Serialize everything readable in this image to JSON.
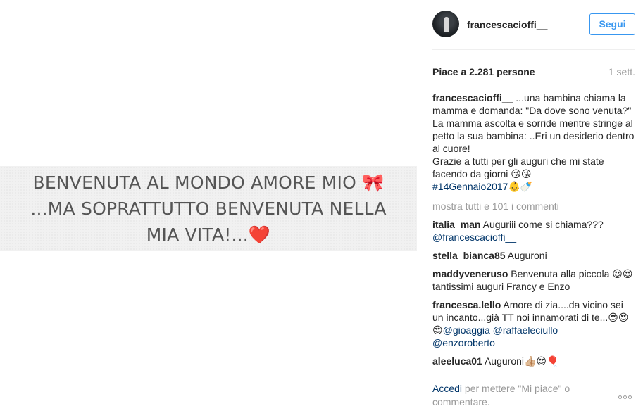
{
  "media": {
    "line1": "BENVENUTA AL MONDO AMORE MIO 🎀",
    "line2": "...MA SOPRATTUTTO BENVENUTA NELLA",
    "line3": "MIA VITA!...❤️"
  },
  "header": {
    "username": "francescacioffi__",
    "follow_label": "Segui"
  },
  "stats": {
    "likes": "Piace a 2.281 persone",
    "time": "1 sett."
  },
  "caption": {
    "user": "francescacioffi__",
    "text1": " ...una bambina chiama la mamma e domanda: \"Da dove sono venuta?\"",
    "text2": "La mamma ascolta e sorride mentre stringe al petto la sua bambina: ..Eri un desiderio dentro al cuore!",
    "text3": "Grazie a tutti per gli auguri che mi state facendo da giorni 😘😘",
    "hashtag": "#14Gennaio2017",
    "hashtag_emoji": "👶🍼"
  },
  "more_comments": "mostra tutti e 101 i commenti",
  "comments": [
    {
      "user": "italia_man",
      "text": " Auguriii come si chiama???",
      "mention": "@francescacioffi__"
    },
    {
      "user": "stella_bianca85",
      "text": " Auguroni"
    },
    {
      "user": "maddyveneruso",
      "text": " Benvenuta alla piccola 😍😍tantissimi auguri Francy e Enzo"
    },
    {
      "user": "francesca.lello",
      "text": " Amore di zia....da vicino sei un incanto...già TT noi innamorati di te...😍😍😍",
      "mention1": "@gioaggia",
      "mention2": "@raffaeleciullo",
      "mention3": "@enzoroberto_"
    },
    {
      "user": "aleeluca01",
      "text": " Auguroni👍🏼😍🎈"
    }
  ],
  "footer": {
    "login": "Accedi",
    "rest": " per mettere \"Mi piace\" o commentare."
  }
}
